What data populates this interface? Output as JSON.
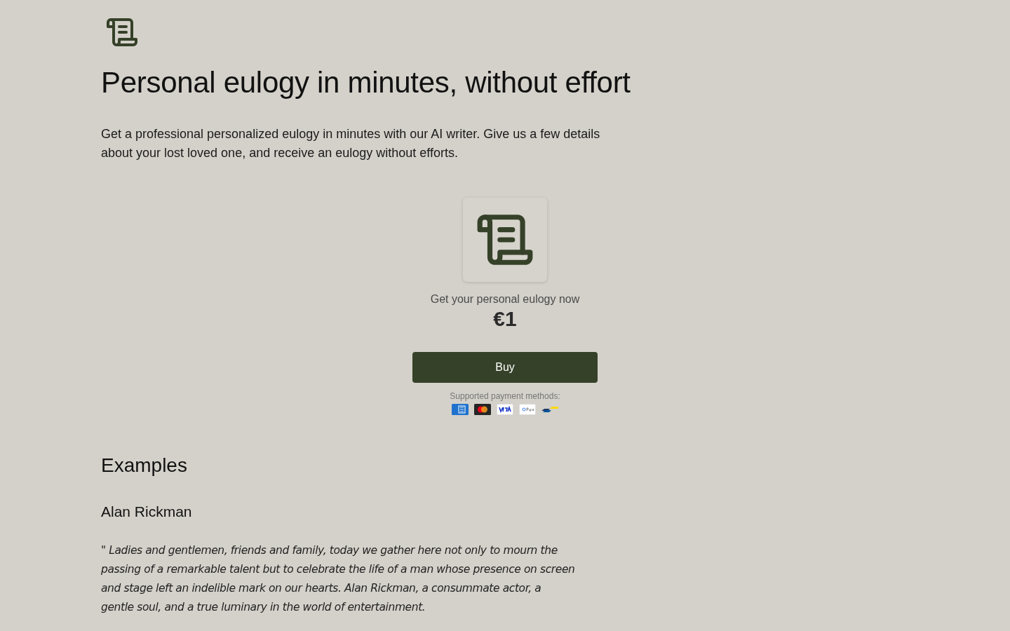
{
  "hero": {
    "title": "Personal eulogy in minutes, without effort",
    "description": "Get a professional personalized eulogy in minutes with our AI writer. Give us a few details about your lost loved one, and receive an eulogy without efforts."
  },
  "offer": {
    "caption": "Get your personal eulogy now",
    "price": "€1",
    "button": "Buy",
    "payment_label": "Supported payment methods:",
    "payment_methods": [
      {
        "kind": "amex"
      },
      {
        "kind": "mastercard"
      },
      {
        "kind": "visa"
      },
      {
        "kind": "gpay"
      },
      {
        "kind": "bancontact"
      }
    ]
  },
  "examples": {
    "heading": "Examples",
    "items": [
      {
        "name": "Alan Rickman",
        "quote_lines": [
          "\" Ladies and gentlemen, friends and family, today we gather here not only to mourn the",
          "passing of a remarkable talent but to celebrate the life of a man whose presence on screen",
          "and stage left an indelible mark on our hearts. Alan Rickman, a consummate actor, a",
          "gentle soul, and a true luminary in the world of entertainment."
        ]
      }
    ]
  }
}
